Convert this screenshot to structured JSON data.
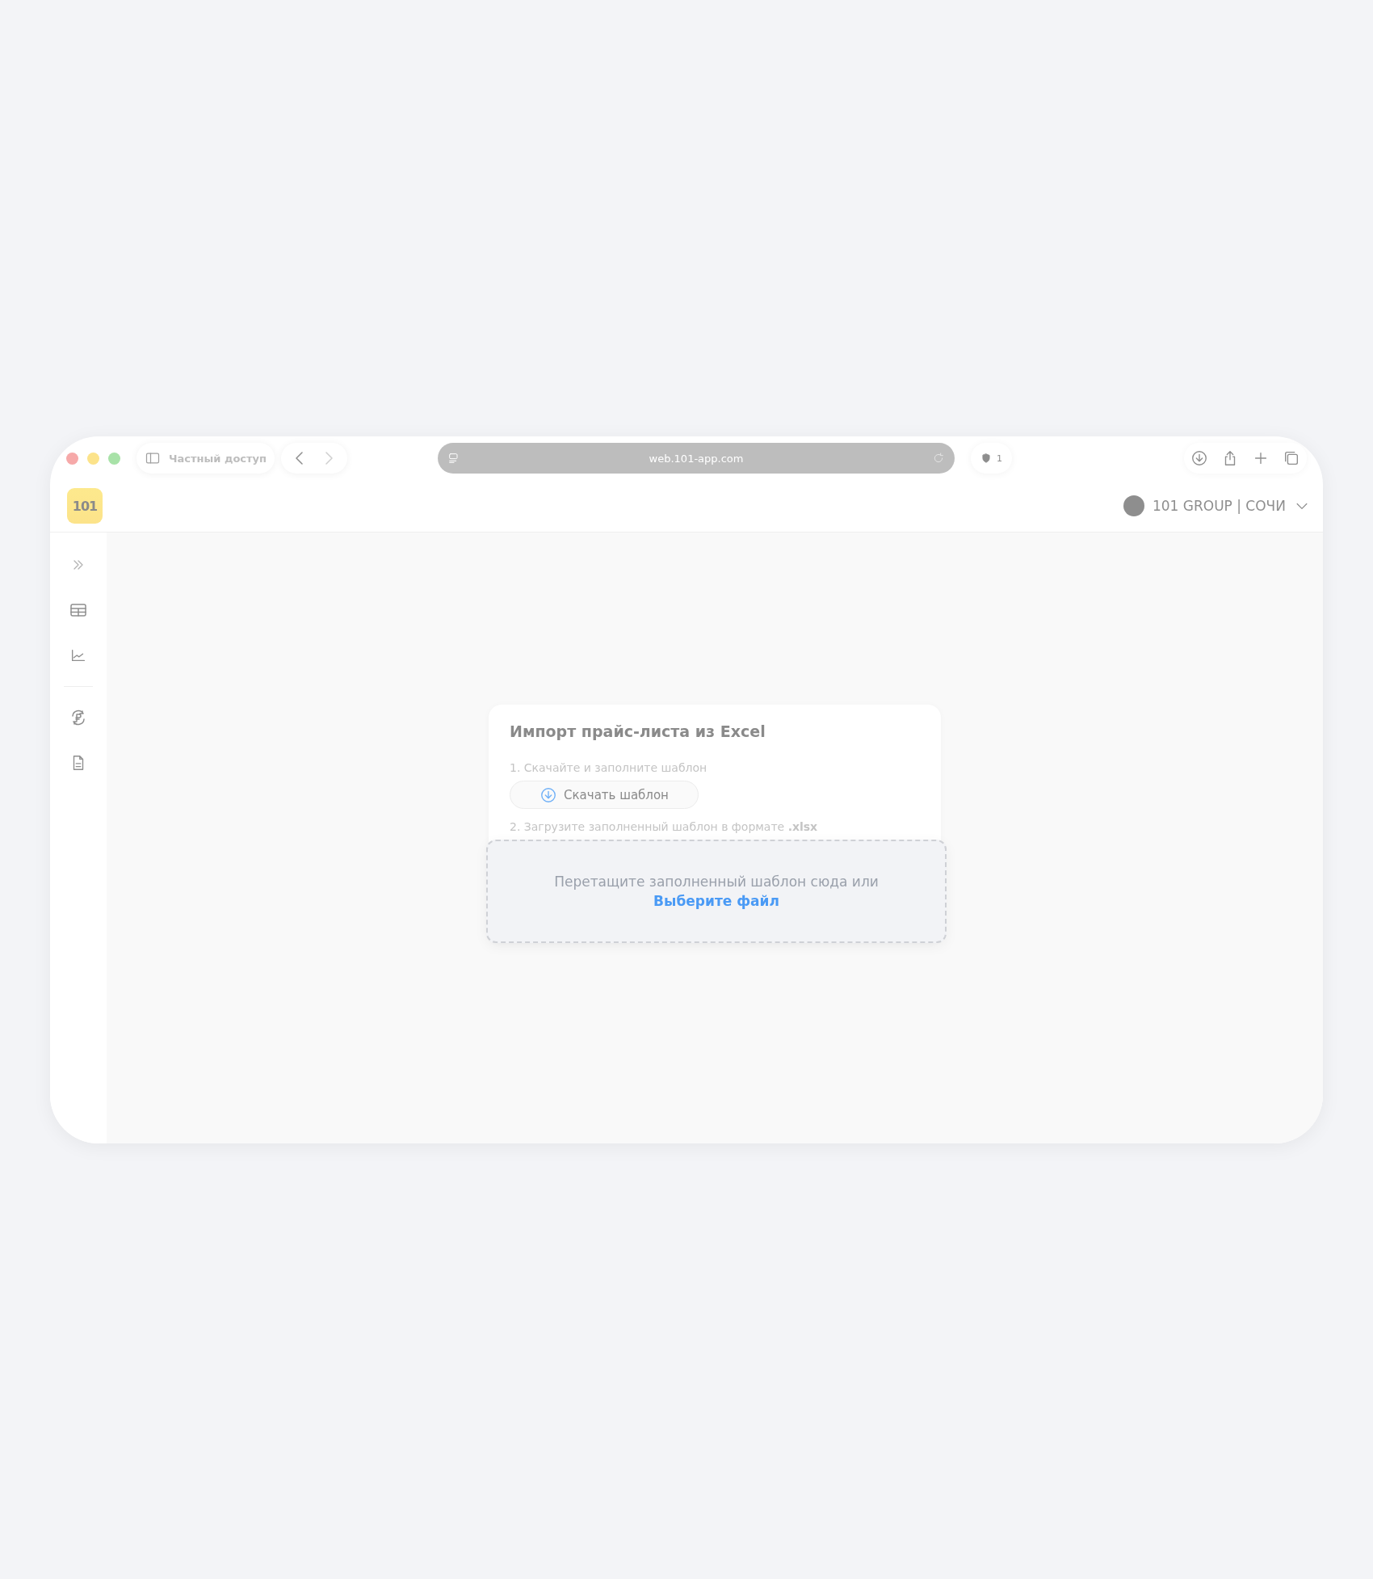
{
  "browser": {
    "private_label": "Частный доступ",
    "back_disabled": false,
    "forward_disabled": true,
    "url": "web.101-app.com",
    "shield_count": "1"
  },
  "app": {
    "logo": "101",
    "account": "101 GROUP | СОЧИ"
  },
  "import_card": {
    "title": "Импорт прайс-листа из Excel",
    "steps": [
      "1. Скачайте и заполните шаблон",
      "2. Загрузите заполненный шаблон в формате **.xlsx**"
    ],
    "download_button": "Скачать шаблон",
    "dropzone": {
      "text": "Перетащите заполненный шаблон сюда или",
      "link": "Выберите файл"
    }
  }
}
